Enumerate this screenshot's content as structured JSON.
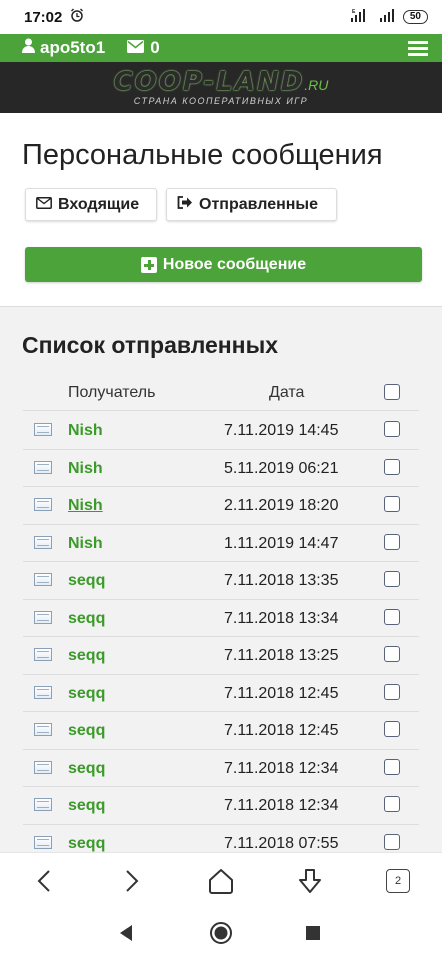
{
  "status_bar": {
    "time": "17:02",
    "battery": "50",
    "signal": "E"
  },
  "topbar": {
    "username": "apo5to1",
    "mail_count": "0"
  },
  "logo": {
    "main": "COOP-LAND",
    "suffix": ".RU",
    "tagline": "СТРАНА КООПЕРАТИВНЫХ ИГР"
  },
  "page": {
    "title": "Персональные сообщения",
    "inbox_label": "Входящие",
    "sent_label": "Отправленные",
    "new_message_label": "Новое сообщение"
  },
  "list": {
    "title": "Список отправленных",
    "headers": {
      "recipient": "Получатель",
      "date": "Дата"
    },
    "rows": [
      {
        "recipient": "Nish",
        "date": "7.11.2019 14:45"
      },
      {
        "recipient": "Nish",
        "date": "5.11.2019 06:21"
      },
      {
        "recipient": "Nish",
        "date": "2.11.2019 18:20"
      },
      {
        "recipient": "Nish",
        "date": "1.11.2019 14:47"
      },
      {
        "recipient": "seqq",
        "date": "7.11.2018 13:35"
      },
      {
        "recipient": "seqq",
        "date": "7.11.2018 13:34"
      },
      {
        "recipient": "seqq",
        "date": "7.11.2018 13:25"
      },
      {
        "recipient": "seqq",
        "date": "7.11.2018 12:45"
      },
      {
        "recipient": "seqq",
        "date": "7.11.2018 12:45"
      },
      {
        "recipient": "seqq",
        "date": "7.11.2018 12:34"
      },
      {
        "recipient": "seqq",
        "date": "7.11.2018 12:34"
      },
      {
        "recipient": "seqq",
        "date": "7.11.2018 07:55"
      }
    ]
  },
  "browser": {
    "tab_count": "2"
  },
  "colors": {
    "accent_green": "#4ca33a",
    "link_green": "#3b9a2a",
    "logo_bar": "#272727"
  }
}
